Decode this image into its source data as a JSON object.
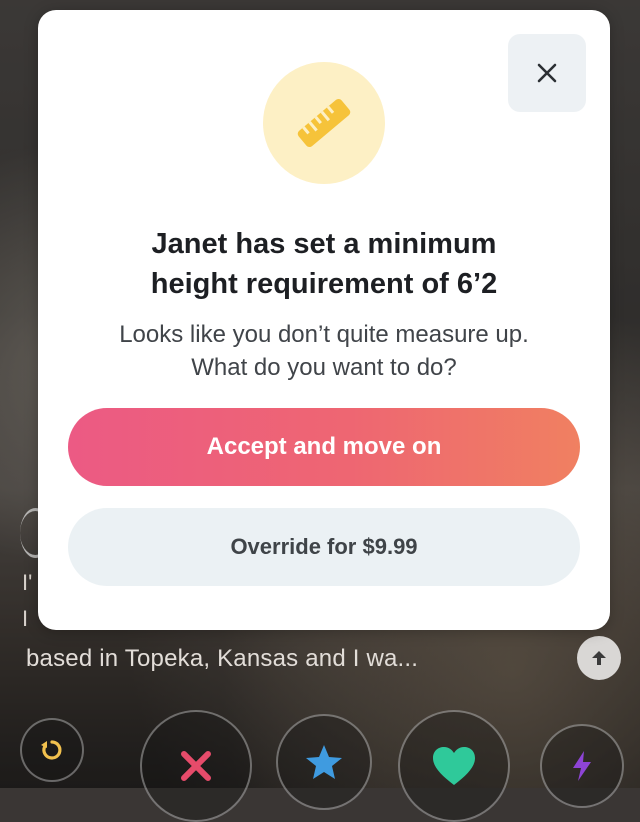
{
  "modal": {
    "title_line1": "Janet has set a minimum",
    "title_line2": "height requirement of 6’2",
    "subtitle_line1": "Looks like you don’t quite measure up.",
    "subtitle_line2": "What do you want to do?",
    "icon": "ruler-icon",
    "close_icon": "close-icon",
    "accept_label": "Accept and move on",
    "override_label": "Override for $9.99"
  },
  "profile": {
    "bio_text": "based in Topeka, Kansas and I wa...",
    "bio_fragment_1": "I'",
    "bio_fragment_2": "I"
  },
  "actions": {
    "icons": [
      "rewind-icon",
      "nope-icon",
      "super-like-icon",
      "like-icon",
      "boost-icon"
    ]
  },
  "colors": {
    "accent_gradient_start": "#ec5a84",
    "accent_gradient_end": "#f08061",
    "ruler": "#f6c33a",
    "nope": "#e64b6a",
    "star": "#3f9be0",
    "like": "#2fc99a",
    "boost": "#8e44d6"
  }
}
